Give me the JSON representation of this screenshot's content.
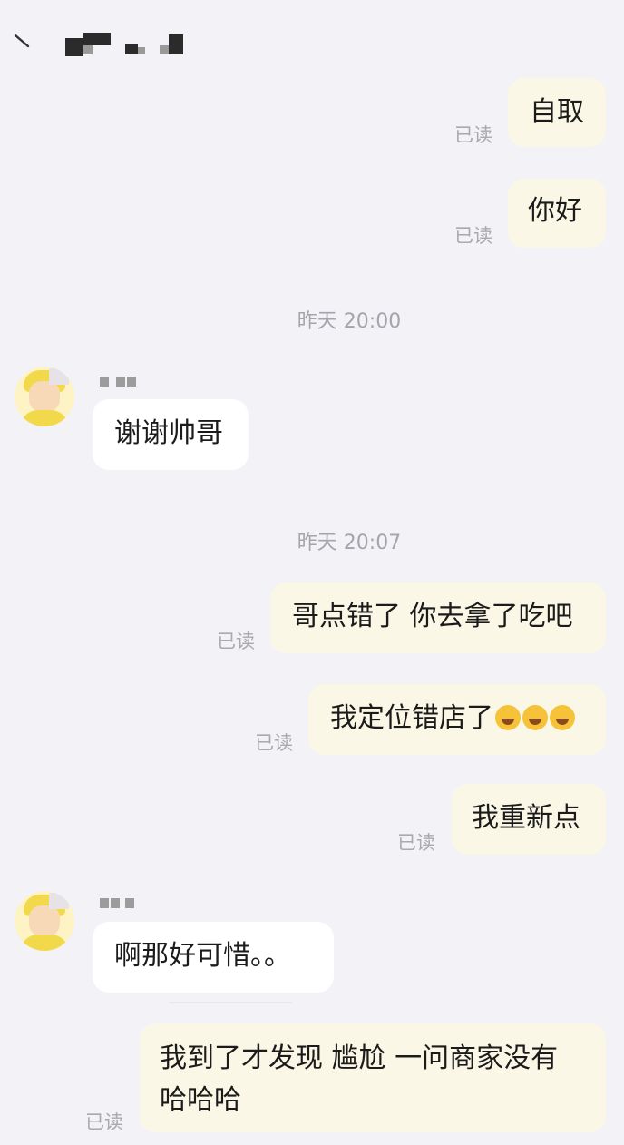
{
  "conversation": {
    "messages": [
      {
        "type": "out",
        "text": "自取",
        "read_label": "已读"
      },
      {
        "type": "out",
        "text": "你好",
        "read_label": "已读"
      },
      {
        "type": "time",
        "text": "昨天 20:00"
      },
      {
        "type": "in",
        "text": "谢谢帅哥"
      },
      {
        "type": "time",
        "text": "昨天 20:07"
      },
      {
        "type": "out",
        "text": "哥点错了 你去拿了吃吧",
        "read_label": "已读"
      },
      {
        "type": "out",
        "text": "我定位错店了",
        "emoji": [
          "laughing-with-tears",
          "laughing-with-tears",
          "laughing-with-tears"
        ],
        "read_label": "已读"
      },
      {
        "type": "out",
        "text": "我重新点",
        "read_label": "已读"
      },
      {
        "type": "in",
        "text": "啊那好可惜。。"
      },
      {
        "type": "out",
        "text_lines": [
          "我到了才发现 尴尬 一问商家没有",
          "哈哈哈"
        ],
        "read_label": "已读"
      }
    ]
  },
  "colors": {
    "background": "#f3f2f7",
    "outgoing_bubble": "#fbf7e6",
    "incoming_bubble": "#ffffff",
    "read_label": "#a9a9ae",
    "timestamp": "#a4a4aa"
  }
}
